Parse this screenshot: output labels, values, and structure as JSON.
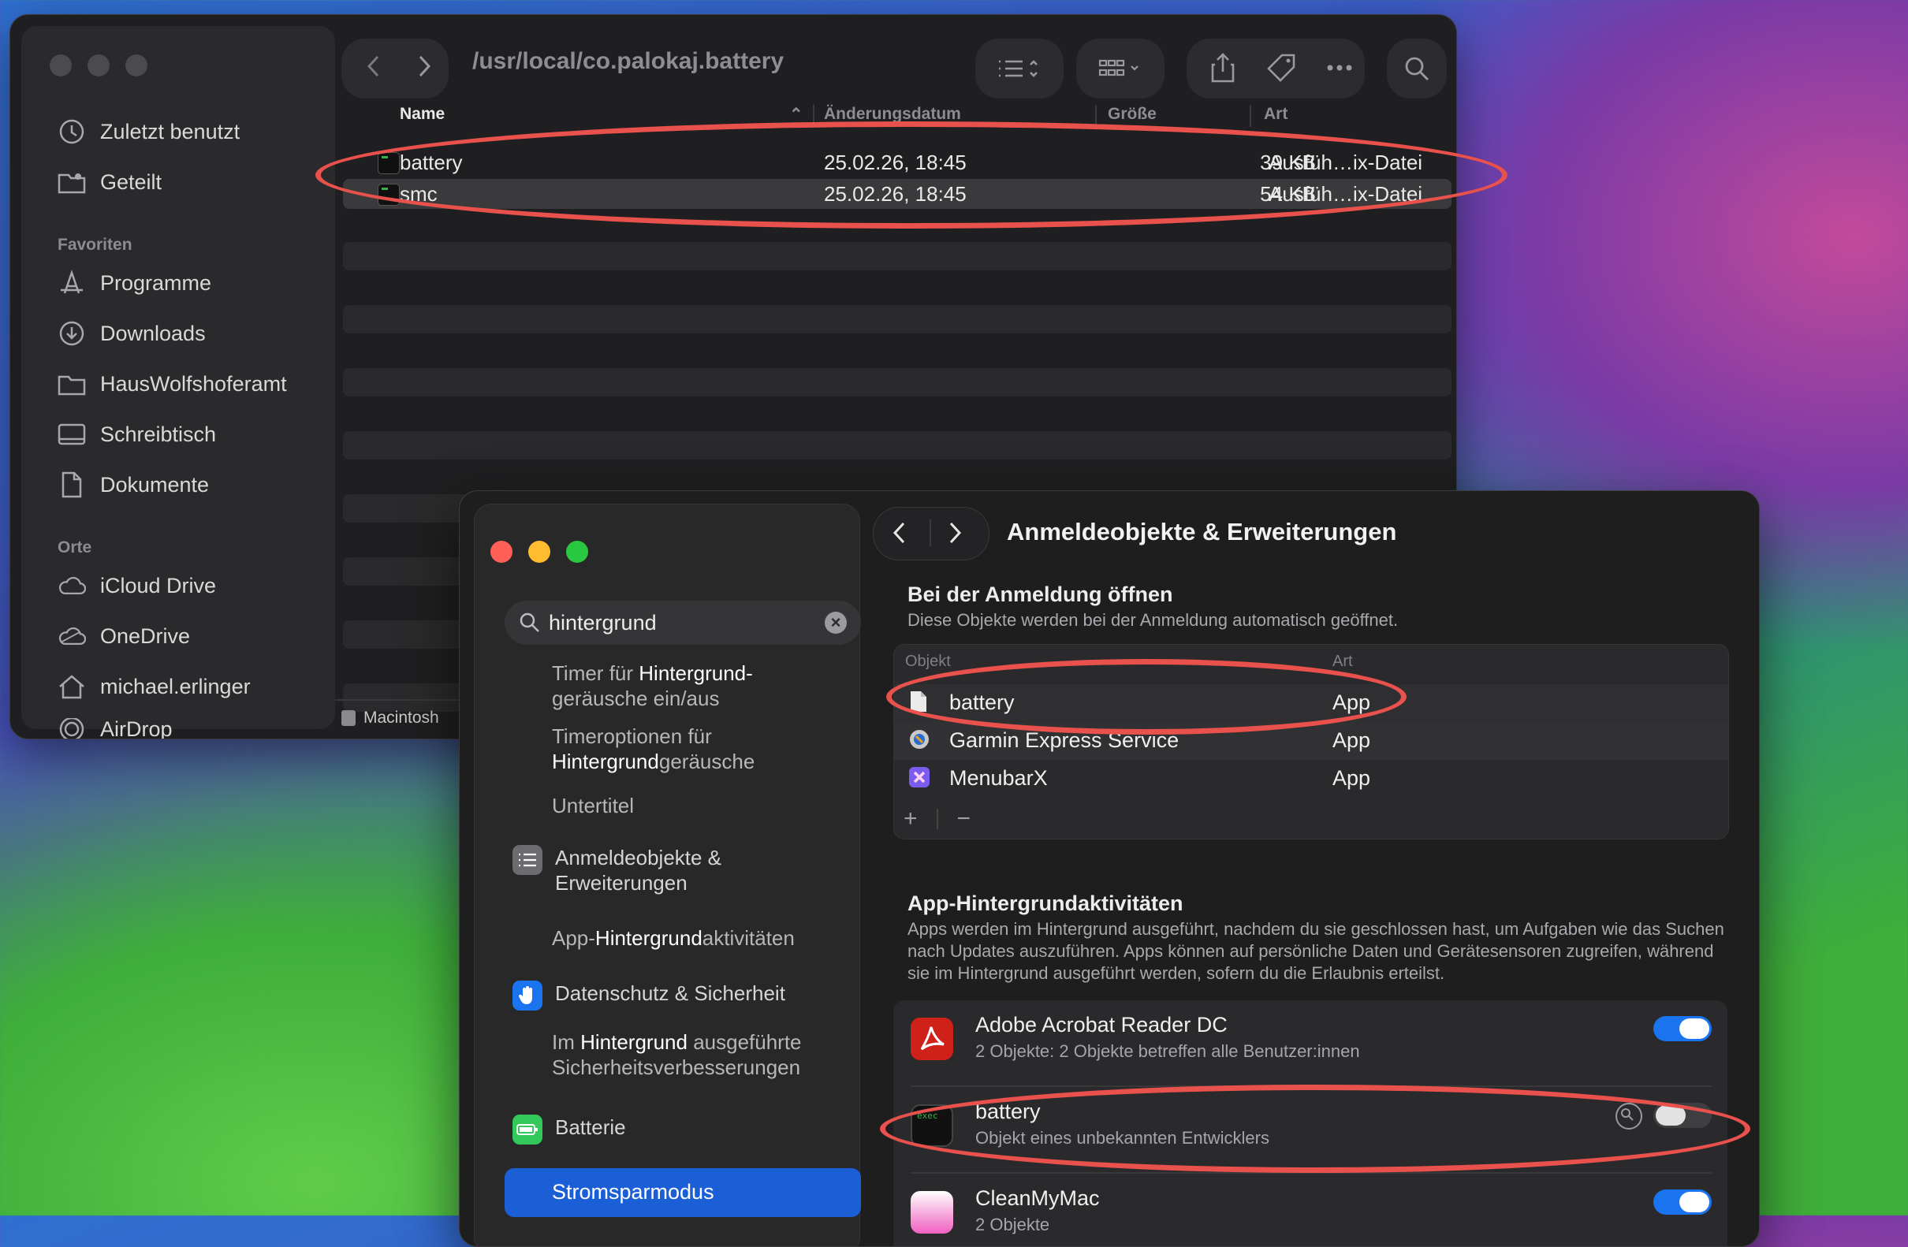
{
  "finder": {
    "path": "/usr/local/co.palokaj.battery",
    "sidebar": {
      "items_top": [
        {
          "label": "Zuletzt benutzt",
          "icon": "clock-icon"
        },
        {
          "label": "Geteilt",
          "icon": "shared-folder-icon"
        }
      ],
      "favorites_heading": "Favoriten",
      "favorites": [
        {
          "label": "Programme",
          "icon": "apps-icon"
        },
        {
          "label": "Downloads",
          "icon": "download-icon"
        },
        {
          "label": "HausWolfshoferamt",
          "icon": "folder-icon"
        },
        {
          "label": "Schreibtisch",
          "icon": "desktop-icon"
        },
        {
          "label": "Dokumente",
          "icon": "document-icon"
        }
      ],
      "places_heading": "Orte",
      "places": [
        {
          "label": "iCloud Drive",
          "icon": "cloud-icon"
        },
        {
          "label": "OneDrive",
          "icon": "cloud-icon"
        },
        {
          "label": "michael.erlinger",
          "icon": "home-icon"
        },
        {
          "label": "AirDrop",
          "icon": "airdrop-icon"
        }
      ]
    },
    "columns": {
      "name": "Name",
      "date": "Änderungsdatum",
      "size": "Größe",
      "kind": "Art"
    },
    "files": [
      {
        "name": "battery",
        "date": "25.02.26, 18:45",
        "size": "39 KB",
        "kind": "Ausfüh…ix-Datei"
      },
      {
        "name": "smc",
        "date": "25.02.26, 18:45",
        "size": "54 KB",
        "kind": "Ausfüh…ix-Datei"
      }
    ],
    "status": "Macintosh"
  },
  "prefs": {
    "search": {
      "value": "hintergrund"
    },
    "results": {
      "r1a": "Timer für ",
      "r1b": "Hintergrund-",
      "r1c": "geräusche ein/aus",
      "r2a": "Timeroptionen für",
      "r2b": "Hintergrund",
      "r2c": "geräusche",
      "r3": "Untertitel",
      "cat1": "Anmeldeobjekte &",
      "cat1b": "Erweiterungen",
      "r4a": "App-",
      "r4b": "Hintergrund",
      "r4c": "aktivitäten",
      "cat2": "Datenschutz & Sicherheit",
      "r5a": "Im ",
      "r5b": "Hintergrund",
      "r5c": " ausgeführte",
      "r5d": "Sicherheitsverbesserungen",
      "cat3": "Batterie",
      "selected": "Stromsparmodus"
    },
    "title": "Anmeldeobjekte & Erweiterungen",
    "login": {
      "heading": "Bei der Anmeldung öffnen",
      "sub": "Diese Objekte werden bei der Anmeldung automatisch geöffnet.",
      "col_obj": "Objekt",
      "col_kind": "Art",
      "items": [
        {
          "name": "battery",
          "kind": "App"
        },
        {
          "name": "Garmin Express Service",
          "kind": "App"
        },
        {
          "name": "MenubarX",
          "kind": "App"
        }
      ],
      "plus": "+",
      "minus": "−"
    },
    "background": {
      "heading": "App-Hintergrundaktivitäten",
      "sub": "Apps werden im Hintergrund ausgeführt, nachdem du sie geschlossen hast, um Aufgaben wie das Suchen nach Updates auszuführen. Apps können auf persönliche Daten und Gerätesensoren zugreifen, während sie im Hintergrund ausgeführt werden, sofern du die Erlaubnis erteilst.",
      "apps": [
        {
          "name": "Adobe Acrobat Reader DC",
          "desc": "2 Objekte: 2 Objekte betreffen alle Benutzer:innen",
          "enabled": true
        },
        {
          "name": "battery",
          "desc": "Objekt eines unbekannten Entwicklers",
          "enabled": false,
          "icon_text": "exec"
        },
        {
          "name": "CleanMyMac",
          "desc": "2 Objekte",
          "enabled": true
        }
      ]
    }
  },
  "colors": {
    "accent": "#1a74f0",
    "highlight_ring": "#e8514c",
    "selection": "#1a5fd6"
  }
}
